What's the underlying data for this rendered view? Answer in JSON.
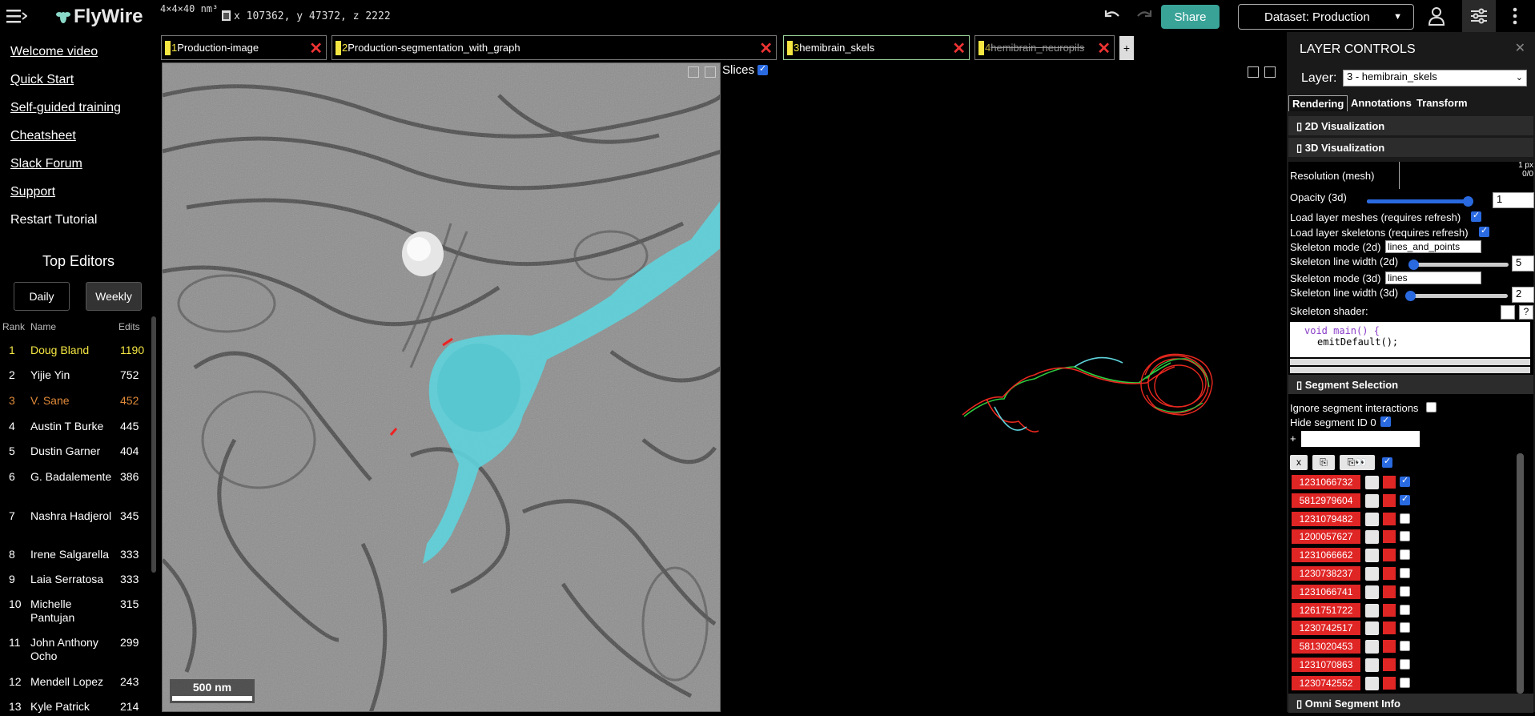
{
  "header": {
    "logo_text": "FlyWire",
    "resolution": "4×4×40 nm³",
    "coords": "x 107362, y 47372, z 2222",
    "share_label": "Share",
    "dataset_label": "Dataset: Production"
  },
  "sidebar": {
    "links": [
      "Welcome video",
      "Quick Start",
      "Self-guided training",
      "Cheatsheet",
      "Slack Forum",
      "Support"
    ],
    "restart": "Restart Tutorial",
    "top_editors_title": "Top Editors",
    "daily_label": "Daily",
    "weekly_label": "Weekly",
    "col_rank": "Rank",
    "col_name": "Name",
    "col_edits": "Edits",
    "rows": [
      {
        "rank": "1",
        "name": "Doug Bland",
        "edits": "1190"
      },
      {
        "rank": "2",
        "name": "Yijie Yin",
        "edits": "752"
      },
      {
        "rank": "3",
        "name": "V. Sane",
        "edits": "452"
      },
      {
        "rank": "4",
        "name": "Austin T Burke",
        "edits": "445"
      },
      {
        "rank": "5",
        "name": "Dustin Garner",
        "edits": "404"
      },
      {
        "rank": "6",
        "name": "G. Badalemente",
        "edits": "386"
      },
      {
        "rank": "7",
        "name": "Nashra Hadjerol",
        "edits": "345"
      },
      {
        "rank": "8",
        "name": "Irene Salgarella",
        "edits": "333"
      },
      {
        "rank": "9",
        "name": "Laia Serratosa",
        "edits": "333"
      },
      {
        "rank": "10",
        "name": "Michelle Pantujan",
        "edits": "315"
      },
      {
        "rank": "11",
        "name": "John Anthony Ocho",
        "edits": "299"
      },
      {
        "rank": "12",
        "name": "Mendell Lopez",
        "edits": "243"
      },
      {
        "rank": "13",
        "name": "Kyle Patrick",
        "edits": "214"
      }
    ],
    "gold_color": "#f5e642",
    "bronze_color": "#e08a3a"
  },
  "layer_tabs": [
    {
      "num": "1",
      "name": "Production-image"
    },
    {
      "num": "2",
      "name": "Production-segmentation_with_graph"
    },
    {
      "num": "3",
      "name": "hemibrain_skels"
    },
    {
      "num": "4",
      "name": "hemibrain_neuropils"
    }
  ],
  "add_tab_label": "+",
  "view": {
    "slices_label": "Slices",
    "scale_label": "500 nm",
    "segment_color": "#5fd3dc"
  },
  "layer_controls": {
    "title": "LAYER CONTROLS",
    "layer_label": "Layer:",
    "layer_value": "3 - hemibrain_skels",
    "tabs": [
      "Rendering",
      "Annotations",
      "Transform"
    ],
    "sec_2d": "2D Visualization",
    "sec_3d": "3D Visualization",
    "resolution_label": "Resolution (mesh)",
    "resolution_value": "1 px",
    "resolution_sub": "0/0",
    "opacity_label": "Opacity (3d)",
    "opacity_value": "1",
    "load_meshes": "Load layer meshes (requires refresh)",
    "load_skeletons": "Load layer skeletons (requires refresh)",
    "skel_mode_2d_label": "Skeleton mode (2d)",
    "skel_mode_2d_value": "lines_and_points",
    "skel_width_2d_label": "Skeleton line width (2d)",
    "skel_width_2d_value": "5",
    "skel_mode_3d_label": "Skeleton mode (3d)",
    "skel_mode_3d_value": "lines",
    "skel_width_3d_label": "Skeleton line width (3d)",
    "skel_width_3d_value": "2",
    "shader_label": "Skeleton shader:",
    "shader_help": "?",
    "shader_line1": "void main() {",
    "shader_line2": "emitDefault();",
    "sec_segment": "Segment Selection",
    "ignore_label": "Ignore segment interactions",
    "hide_label": "Hide segment ID 0",
    "plus_label": "+",
    "clear_label": "x",
    "segments": [
      {
        "id": "1231066732",
        "visible": true
      },
      {
        "id": "5812979604",
        "visible": true
      },
      {
        "id": "1231079482",
        "visible": false
      },
      {
        "id": "1200057627",
        "visible": false
      },
      {
        "id": "1231066662",
        "visible": false
      },
      {
        "id": "1230738237",
        "visible": false
      },
      {
        "id": "1231066741",
        "visible": false
      },
      {
        "id": "1261751722",
        "visible": false
      },
      {
        "id": "1230742517",
        "visible": false
      },
      {
        "id": "5813020453",
        "visible": false
      },
      {
        "id": "1231070863",
        "visible": false
      },
      {
        "id": "1230742552",
        "visible": false
      }
    ],
    "sec_omni": "Omni Segment Info"
  }
}
